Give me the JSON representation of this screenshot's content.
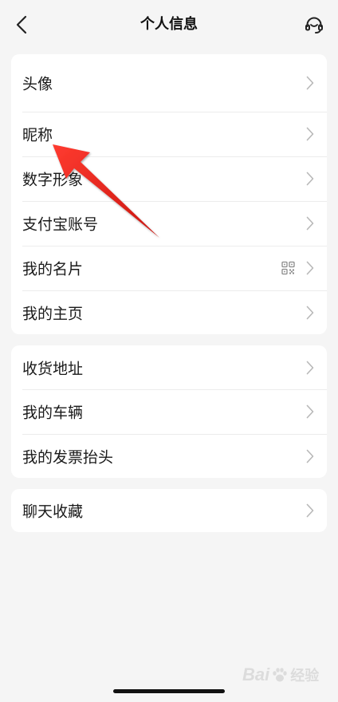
{
  "header": {
    "title": "个人信息",
    "back_icon": "back-arrow-icon",
    "service_icon": "headset-icon"
  },
  "groups": [
    {
      "items": [
        {
          "label": "头像",
          "trailing_icon": "chevron-right-icon"
        },
        {
          "label": "昵称",
          "trailing_icon": "chevron-right-icon"
        },
        {
          "label": "数字形象",
          "trailing_icon": "chevron-right-icon"
        },
        {
          "label": "支付宝账号",
          "trailing_icon": "chevron-right-icon"
        },
        {
          "label": "我的名片",
          "accessory_icon": "qr-code-icon",
          "trailing_icon": "chevron-right-icon"
        },
        {
          "label": "我的主页",
          "trailing_icon": "chevron-right-icon"
        }
      ]
    },
    {
      "items": [
        {
          "label": "收货地址",
          "trailing_icon": "chevron-right-icon"
        },
        {
          "label": "我的车辆",
          "trailing_icon": "chevron-right-icon"
        },
        {
          "label": "我的发票抬头",
          "trailing_icon": "chevron-right-icon"
        }
      ]
    },
    {
      "items": [
        {
          "label": "聊天收藏",
          "trailing_icon": "chevron-right-icon"
        }
      ]
    }
  ],
  "annotation": {
    "icon": "red-arrow-icon",
    "color": "#e8231d"
  },
  "watermark": {
    "brand": "Bai",
    "icon": "paw-icon",
    "text": "经验"
  },
  "colors": {
    "background": "#f5f5f5",
    "card": "#ffffff",
    "text": "#1a1a1a",
    "chevron": "#b8b8b8",
    "divider": "#ececec"
  }
}
